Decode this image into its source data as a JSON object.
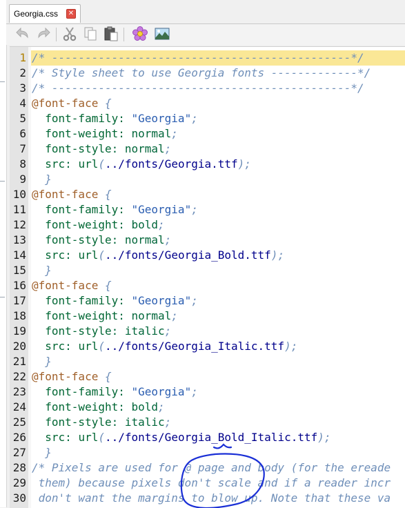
{
  "tab": {
    "label": "Georgia.css",
    "close_glyph": "✕"
  },
  "toolbar": {
    "buttons": [
      {
        "name": "undo-button",
        "icon": "undo-icon"
      },
      {
        "name": "redo-button",
        "icon": "redo-icon"
      },
      {
        "name": "cut-button",
        "icon": "scissors-icon"
      },
      {
        "name": "copy-button",
        "icon": "copy-icon"
      },
      {
        "name": "paste-button",
        "icon": "clipboard-icon"
      },
      {
        "name": "flower-button",
        "icon": "flower-icon"
      },
      {
        "name": "image-button",
        "icon": "image-icon"
      }
    ]
  },
  "editor": {
    "current_line": 1,
    "lines": [
      {
        "n": "1",
        "segs": [
          {
            "c": "com",
            "t": "/* ---------------------------------------------*/"
          }
        ]
      },
      {
        "n": "2",
        "segs": [
          {
            "c": "com",
            "t": "/* Style sheet to use Georgia fonts -------------*/"
          }
        ]
      },
      {
        "n": "3",
        "segs": [
          {
            "c": "com",
            "t": "/* ---------------------------------------------*/"
          }
        ]
      },
      {
        "n": "4",
        "segs": [
          {
            "c": "at",
            "t": "@font-face"
          },
          {
            "c": "brace",
            "t": " {"
          }
        ]
      },
      {
        "n": "5",
        "segs": [
          {
            "c": "prop",
            "t": "  font-family"
          },
          {
            "c": "val",
            "t": ": "
          },
          {
            "c": "str",
            "t": "\"Georgia\""
          },
          {
            "c": "pun",
            "t": ";"
          }
        ]
      },
      {
        "n": "6",
        "segs": [
          {
            "c": "prop",
            "t": "  font-weight"
          },
          {
            "c": "val",
            "t": ": normal"
          },
          {
            "c": "pun",
            "t": ";"
          }
        ]
      },
      {
        "n": "7",
        "segs": [
          {
            "c": "prop",
            "t": "  font-style"
          },
          {
            "c": "val",
            "t": ": normal"
          },
          {
            "c": "pun",
            "t": ";"
          }
        ]
      },
      {
        "n": "8",
        "segs": [
          {
            "c": "prop",
            "t": "  src"
          },
          {
            "c": "val",
            "t": ": "
          },
          {
            "c": "url",
            "t": "url"
          },
          {
            "c": "pun",
            "t": "("
          },
          {
            "c": "path",
            "t": "../fonts/Georgia.ttf"
          },
          {
            "c": "pun",
            "t": ");"
          }
        ]
      },
      {
        "n": "9",
        "segs": [
          {
            "c": "brace",
            "t": "  }"
          }
        ]
      },
      {
        "n": "10",
        "segs": [
          {
            "c": "at",
            "t": "@font-face"
          },
          {
            "c": "brace",
            "t": " {"
          }
        ]
      },
      {
        "n": "11",
        "segs": [
          {
            "c": "prop",
            "t": "  font-family"
          },
          {
            "c": "val",
            "t": ": "
          },
          {
            "c": "str",
            "t": "\"Georgia\""
          },
          {
            "c": "pun",
            "t": ";"
          }
        ]
      },
      {
        "n": "12",
        "segs": [
          {
            "c": "prop",
            "t": "  font-weight"
          },
          {
            "c": "val",
            "t": ": bold"
          },
          {
            "c": "pun",
            "t": ";"
          }
        ]
      },
      {
        "n": "13",
        "segs": [
          {
            "c": "prop",
            "t": "  font-style"
          },
          {
            "c": "val",
            "t": ": normal"
          },
          {
            "c": "pun",
            "t": ";"
          }
        ]
      },
      {
        "n": "14",
        "segs": [
          {
            "c": "prop",
            "t": "  src"
          },
          {
            "c": "val",
            "t": ": "
          },
          {
            "c": "url",
            "t": "url"
          },
          {
            "c": "pun",
            "t": "("
          },
          {
            "c": "path",
            "t": "../fonts/Georgia_Bold.ttf"
          },
          {
            "c": "pun",
            "t": ");"
          }
        ]
      },
      {
        "n": "15",
        "segs": [
          {
            "c": "brace",
            "t": "  }"
          }
        ]
      },
      {
        "n": "16",
        "segs": [
          {
            "c": "at",
            "t": "@font-face"
          },
          {
            "c": "brace",
            "t": " {"
          }
        ]
      },
      {
        "n": "17",
        "segs": [
          {
            "c": "prop",
            "t": "  font-family"
          },
          {
            "c": "val",
            "t": ": "
          },
          {
            "c": "str",
            "t": "\"Georgia\""
          },
          {
            "c": "pun",
            "t": ";"
          }
        ]
      },
      {
        "n": "18",
        "segs": [
          {
            "c": "prop",
            "t": "  font-weight"
          },
          {
            "c": "val",
            "t": ": normal"
          },
          {
            "c": "pun",
            "t": ";"
          }
        ]
      },
      {
        "n": "19",
        "segs": [
          {
            "c": "prop",
            "t": "  font-style"
          },
          {
            "c": "val",
            "t": ": italic"
          },
          {
            "c": "pun",
            "t": ";"
          }
        ]
      },
      {
        "n": "20",
        "segs": [
          {
            "c": "prop",
            "t": "  src"
          },
          {
            "c": "val",
            "t": ": "
          },
          {
            "c": "url",
            "t": "url"
          },
          {
            "c": "pun",
            "t": "("
          },
          {
            "c": "path",
            "t": "../fonts/Georgia_Italic.ttf"
          },
          {
            "c": "pun",
            "t": ");"
          }
        ]
      },
      {
        "n": "21",
        "segs": [
          {
            "c": "brace",
            "t": "  }"
          }
        ]
      },
      {
        "n": "22",
        "segs": [
          {
            "c": "at",
            "t": "@font-face"
          },
          {
            "c": "brace",
            "t": " {"
          }
        ]
      },
      {
        "n": "23",
        "segs": [
          {
            "c": "prop",
            "t": "  font-family"
          },
          {
            "c": "val",
            "t": ": "
          },
          {
            "c": "str",
            "t": "\"Georgia\""
          },
          {
            "c": "pun",
            "t": ";"
          }
        ]
      },
      {
        "n": "24",
        "segs": [
          {
            "c": "prop",
            "t": "  font-weight"
          },
          {
            "c": "val",
            "t": ": bold"
          },
          {
            "c": "pun",
            "t": ";"
          }
        ]
      },
      {
        "n": "25",
        "segs": [
          {
            "c": "prop",
            "t": "  font-style"
          },
          {
            "c": "val",
            "t": ": italic"
          },
          {
            "c": "pun",
            "t": ";"
          }
        ]
      },
      {
        "n": "26",
        "segs": [
          {
            "c": "prop",
            "t": "  src"
          },
          {
            "c": "val",
            "t": ": "
          },
          {
            "c": "url",
            "t": "url"
          },
          {
            "c": "pun",
            "t": "("
          },
          {
            "c": "path",
            "t": "../fonts/Georgia_Bold_Italic.ttf"
          },
          {
            "c": "pun",
            "t": ");"
          }
        ]
      },
      {
        "n": "27",
        "segs": [
          {
            "c": "brace",
            "t": "  }"
          }
        ]
      },
      {
        "n": "28",
        "segs": [
          {
            "c": "com",
            "t": "/* Pixels are used for @ page and body (for the ereade"
          }
        ]
      },
      {
        "n": "29",
        "segs": [
          {
            "c": "com",
            "t": " them) because pixels don't scale and if a reader incr"
          }
        ]
      },
      {
        "n": "30",
        "segs": [
          {
            "c": "com",
            "t": " don't want the margins to blow up. Note that these va"
          }
        ]
      }
    ]
  },
  "colors": {
    "current_line_bg": "#fae796",
    "comment": "#6f8fb9",
    "at_rule": "#a0602a",
    "property": "#006633",
    "string": "#2a5db0",
    "path": "#00008b",
    "annotation": "#1a2fd6"
  }
}
